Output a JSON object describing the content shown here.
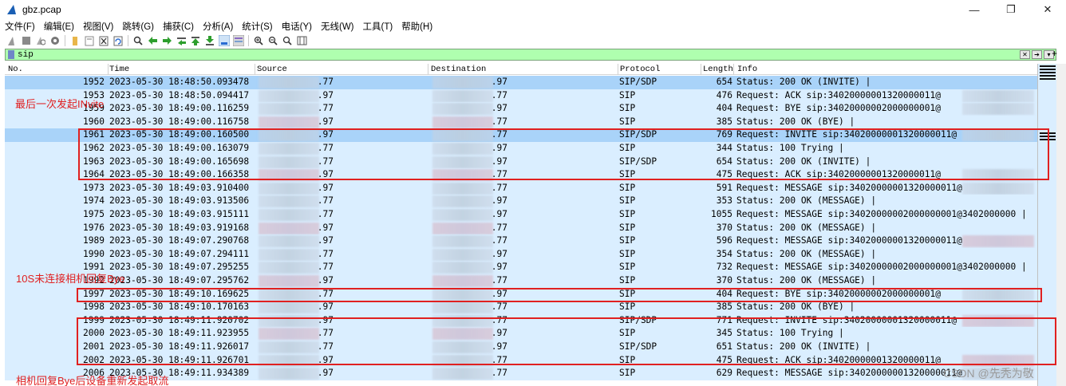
{
  "window": {
    "title": "gbz.pcap",
    "controls": {
      "minimize": "—",
      "maximize": "❐",
      "close": "✕"
    },
    "icon": "shark-fin-icon"
  },
  "menu": [
    "文件(F)",
    "编辑(E)",
    "视图(V)",
    "跳转(G)",
    "捕获(C)",
    "分析(A)",
    "统计(S)",
    "电话(Y)",
    "无线(W)",
    "工具(T)",
    "帮助(H)"
  ],
  "toolbar_icons": [
    "start-capture-icon",
    "stop-capture-icon",
    "restart-capture-icon",
    "capture-options-icon",
    "open-file-icon",
    "save-file-icon",
    "close-file-icon",
    "reload-file-icon",
    "find-packet-icon",
    "go-back-icon",
    "go-forward-icon",
    "go-to-packet-icon",
    "go-first-icon",
    "go-last-icon",
    "autoscroll-icon",
    "colorize-icon",
    "zoom-in-icon",
    "zoom-out-icon",
    "zoom-normal-icon",
    "resize-columns-icon"
  ],
  "filter": {
    "value": "sip",
    "color": "#afffaf"
  },
  "columns": {
    "no": "No.",
    "time": "Time",
    "source": "Source",
    "destination": "Destination",
    "protocol": "Protocol",
    "length": "Length",
    "info": "Info"
  },
  "packets": [
    {
      "no": "1952",
      "time": "2023-05-30 18:48:50.093478",
      "src": ".77",
      "dst": ".97",
      "proto": "SIP/SDP",
      "len": "654",
      "info": "Status: 200 OK (INVITE) |",
      "selected": true
    },
    {
      "no": "1953",
      "time": "2023-05-30 18:48:50.094417",
      "src": ".97",
      "dst": ".77",
      "proto": "SIP",
      "len": "476",
      "info": "Request: ACK sip:34020000001320000011@"
    },
    {
      "no": "1959",
      "time": "2023-05-30 18:49:00.116259",
      "src": ".77",
      "dst": ".97",
      "proto": "SIP",
      "len": "404",
      "info": "Request: BYE sip:34020000002000000001@"
    },
    {
      "no": "1960",
      "time": "2023-05-30 18:49:00.116758",
      "src": ".97",
      "dst": ".77",
      "proto": "SIP",
      "len": "385",
      "info": "Status: 200 OK (BYE) |"
    },
    {
      "no": "1961",
      "time": "2023-05-30 18:49:00.160500",
      "src": ".97",
      "dst": ".77",
      "proto": "SIP/SDP",
      "len": "769",
      "info": "Request: INVITE sip:34020000001320000011@",
      "selected": true
    },
    {
      "no": "1962",
      "time": "2023-05-30 18:49:00.163079",
      "src": ".77",
      "dst": ".97",
      "proto": "SIP",
      "len": "344",
      "info": "Status: 100 Trying |"
    },
    {
      "no": "1963",
      "time": "2023-05-30 18:49:00.165698",
      "src": ".77",
      "dst": ".97",
      "proto": "SIP/SDP",
      "len": "654",
      "info": "Status: 200 OK (INVITE) |"
    },
    {
      "no": "1964",
      "time": "2023-05-30 18:49:00.166358",
      "src": ".97",
      "dst": ".77",
      "proto": "SIP",
      "len": "475",
      "info": "Request: ACK sip:34020000001320000011@"
    },
    {
      "no": "1973",
      "time": "2023-05-30 18:49:03.910400",
      "src": ".97",
      "dst": ".77",
      "proto": "SIP",
      "len": "591",
      "info": "Request: MESSAGE sip:34020000001320000011@"
    },
    {
      "no": "1974",
      "time": "2023-05-30 18:49:03.913506",
      "src": ".77",
      "dst": ".97",
      "proto": "SIP",
      "len": "353",
      "info": "Status: 200 OK (MESSAGE) |"
    },
    {
      "no": "1975",
      "time": "2023-05-30 18:49:03.915111",
      "src": ".77",
      "dst": ".97",
      "proto": "SIP",
      "len": "1055",
      "info": "Request: MESSAGE sip:34020000002000000001@3402000000 |"
    },
    {
      "no": "1976",
      "time": "2023-05-30 18:49:03.919168",
      "src": ".97",
      "dst": ".77",
      "proto": "SIP",
      "len": "370",
      "info": "Status: 200 OK (MESSAGE) |"
    },
    {
      "no": "1989",
      "time": "2023-05-30 18:49:07.290768",
      "src": ".97",
      "dst": ".77",
      "proto": "SIP",
      "len": "596",
      "info": "Request: MESSAGE sip:34020000001320000011@"
    },
    {
      "no": "1990",
      "time": "2023-05-30 18:49:07.294111",
      "src": ".77",
      "dst": ".97",
      "proto": "SIP",
      "len": "354",
      "info": "Status: 200 OK (MESSAGE) |"
    },
    {
      "no": "1991",
      "time": "2023-05-30 18:49:07.295255",
      "src": ".77",
      "dst": ".97",
      "proto": "SIP",
      "len": "732",
      "info": "Request: MESSAGE sip:34020000002000000001@3402000000 |"
    },
    {
      "no": "1992",
      "time": "2023-05-30 18:49:07.295762",
      "src": ".97",
      "dst": ".77",
      "proto": "SIP",
      "len": "370",
      "info": "Status: 200 OK (MESSAGE) |"
    },
    {
      "no": "1997",
      "time": "2023-05-30 18:49:10.169625",
      "src": ".77",
      "dst": ".97",
      "proto": "SIP",
      "len": "404",
      "info": "Request: BYE sip:34020000002000000001@"
    },
    {
      "no": "1998",
      "time": "2023-05-30 18:49:10.170163",
      "src": ".97",
      "dst": ".77",
      "proto": "SIP",
      "len": "385",
      "info": "Status: 200 OK (BYE) |"
    },
    {
      "no": "1999",
      "time": "2023-05-30 18:49:11.920702",
      "src": ".97",
      "dst": ".77",
      "proto": "SIP/SDP",
      "len": "771",
      "info": "Request: INVITE sip:34020000001320000011@"
    },
    {
      "no": "2000",
      "time": "2023-05-30 18:49:11.923955",
      "src": ".77",
      "dst": ".97",
      "proto": "SIP",
      "len": "345",
      "info": "Status: 100 Trying |"
    },
    {
      "no": "2001",
      "time": "2023-05-30 18:49:11.926017",
      "src": ".77",
      "dst": ".97",
      "proto": "SIP/SDP",
      "len": "651",
      "info": "Status: 200 OK (INVITE) |"
    },
    {
      "no": "2002",
      "time": "2023-05-30 18:49:11.926701",
      "src": ".97",
      "dst": ".77",
      "proto": "SIP",
      "len": "475",
      "info": "Request: ACK sip:34020000001320000011@"
    },
    {
      "no": "2006",
      "time": "2023-05-30 18:49:11.934389",
      "src": ".97",
      "dst": ".77",
      "proto": "SIP",
      "len": "629",
      "info": "Request: MESSAGE sip:34020000001320000011@"
    }
  ],
  "annotations": {
    "a1": "最后一次发起INvite",
    "a2": "10S未连接相机回复Bye",
    "a3": "相机回复Bye后设备重新发起取流"
  },
  "watermark": "CSDN @先秃为敬",
  "colors": {
    "row_bg": "#daeeff",
    "row_selected": "#a9d3f9",
    "annotation": "#e02020"
  }
}
